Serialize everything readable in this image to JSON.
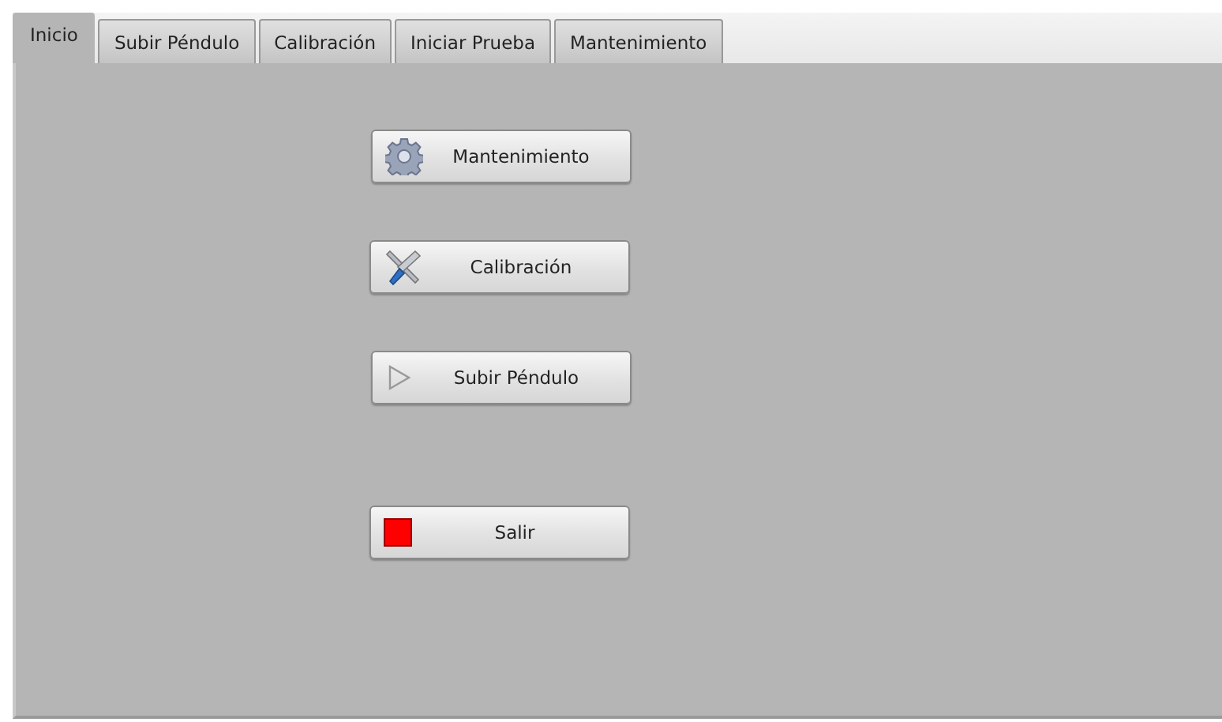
{
  "tabs": [
    {
      "label": "Inicio",
      "selected": true
    },
    {
      "label": "Subir Péndulo",
      "selected": false
    },
    {
      "label": "Calibración",
      "selected": false
    },
    {
      "label": "Iniciar Prueba",
      "selected": false
    },
    {
      "label": "Mantenimiento",
      "selected": false
    }
  ],
  "buttons": [
    {
      "label": "Mantenimiento",
      "kind": "gear"
    },
    {
      "label": "Calibración",
      "kind": "tools"
    },
    {
      "label": "Subir Péndulo",
      "kind": "play"
    },
    {
      "label": "Salir",
      "kind": "stop"
    }
  ]
}
